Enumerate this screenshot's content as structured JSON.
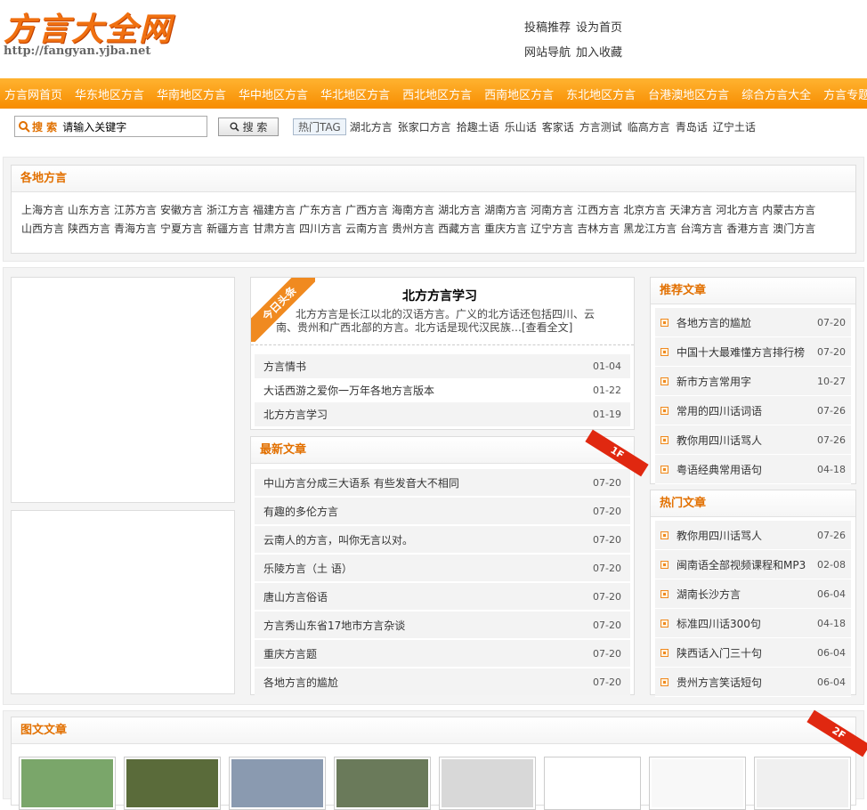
{
  "logo": {
    "text": "方言大全网",
    "url": "http://fangyan.yjba.net"
  },
  "toplinks": [
    "投稿推荐",
    "设为首页",
    "网站导航",
    "加入收藏"
  ],
  "nav": [
    "方言网首页",
    "华东地区方言",
    "华南地区方言",
    "华中地区方言",
    "华北地区方言",
    "西北地区方言",
    "西南地区方言",
    "东北地区方言",
    "台港澳地区方言",
    "综合方言大全",
    "方言专题列表"
  ],
  "search": {
    "label": "搜 索",
    "placeholder": "请输入关键字",
    "button": "搜 索"
  },
  "hottag": {
    "label": "热门TAG",
    "tags": [
      "湖北方言",
      "张家口方言",
      "拾趣土语",
      "乐山话",
      "客家话",
      "方言测试",
      "临高方言",
      "青岛话",
      "辽宁土话"
    ]
  },
  "regions": {
    "title": "各地方言",
    "items": [
      "上海方言",
      "山东方言",
      "江苏方言",
      "安徽方言",
      "浙江方言",
      "福建方言",
      "广东方言",
      "广西方言",
      "海南方言",
      "湖北方言",
      "湖南方言",
      "河南方言",
      "江西方言",
      "北京方言",
      "天津方言",
      "河北方言",
      "内蒙古方言",
      "山西方言",
      "陕西方言",
      "青海方言",
      "宁夏方言",
      "新疆方言",
      "甘肃方言",
      "四川方言",
      "云南方言",
      "贵州方言",
      "西藏方言",
      "重庆方言",
      "辽宁方言",
      "吉林方言",
      "黑龙江方言",
      "台湾方言",
      "香港方言",
      "澳门方言"
    ]
  },
  "headline": {
    "ribbon": "今日头条",
    "title": "北方方言学习",
    "desc": "北方方言是长江以北的汉语方言。广义的北方话还包括四川、云南、贵州和广西北部的方言。北方话是现代汉民族…[查看全文]",
    "items": [
      {
        "t": "方言情书",
        "d": "01-04"
      },
      {
        "t": "大话西游之爱你一万年各地方言版本",
        "d": "01-22"
      },
      {
        "t": "北方方言学习",
        "d": "01-19"
      }
    ]
  },
  "latest": {
    "title": "最新文章",
    "ribbon": "1F",
    "items": [
      {
        "t": "中山方言分成三大语系 有些发音大不相同",
        "d": "07-20"
      },
      {
        "t": "有趣的多伦方言",
        "d": "07-20"
      },
      {
        "t": "云南人的方言，叫你无言以对。",
        "d": "07-20"
      },
      {
        "t": "乐陵方言（土 语）",
        "d": "07-20"
      },
      {
        "t": "唐山方言俗语",
        "d": "07-20"
      },
      {
        "t": "方言秀山东省17地市方言杂谈",
        "d": "07-20"
      },
      {
        "t": "重庆方言题",
        "d": "07-20"
      },
      {
        "t": "各地方言的尴尬",
        "d": "07-20"
      }
    ]
  },
  "recommend": {
    "title": "推荐文章",
    "items": [
      {
        "t": "各地方言的尴尬",
        "d": "07-20"
      },
      {
        "t": "中国十大最难懂方言排行榜",
        "d": "07-20"
      },
      {
        "t": "新市方言常用字",
        "d": "10-27"
      },
      {
        "t": "常用的四川话词语",
        "d": "07-26"
      },
      {
        "t": "教你用四川话骂人",
        "d": "07-26"
      },
      {
        "t": "粤语经典常用语句",
        "d": "04-18"
      }
    ]
  },
  "hot": {
    "title": "热门文章",
    "items": [
      {
        "t": "教你用四川话骂人",
        "d": "07-26"
      },
      {
        "t": "闽南语全部视频课程和MP3",
        "d": "02-08"
      },
      {
        "t": "湖南长沙方言",
        "d": "06-04"
      },
      {
        "t": "标准四川话300句",
        "d": "04-18"
      },
      {
        "t": "陕西话入门三十句",
        "d": "06-04"
      },
      {
        "t": "贵州方言笑话短句",
        "d": "06-04"
      }
    ]
  },
  "gallery": {
    "title": "图文文章",
    "ribbon": "2F",
    "thumb_colors": [
      "#7aa66a",
      "#5a6b3a",
      "#8a9ab0",
      "#6a7a5a",
      "#d8d8d8",
      "#ffffff",
      "#f8f8f8",
      "#f0f0f0"
    ]
  }
}
